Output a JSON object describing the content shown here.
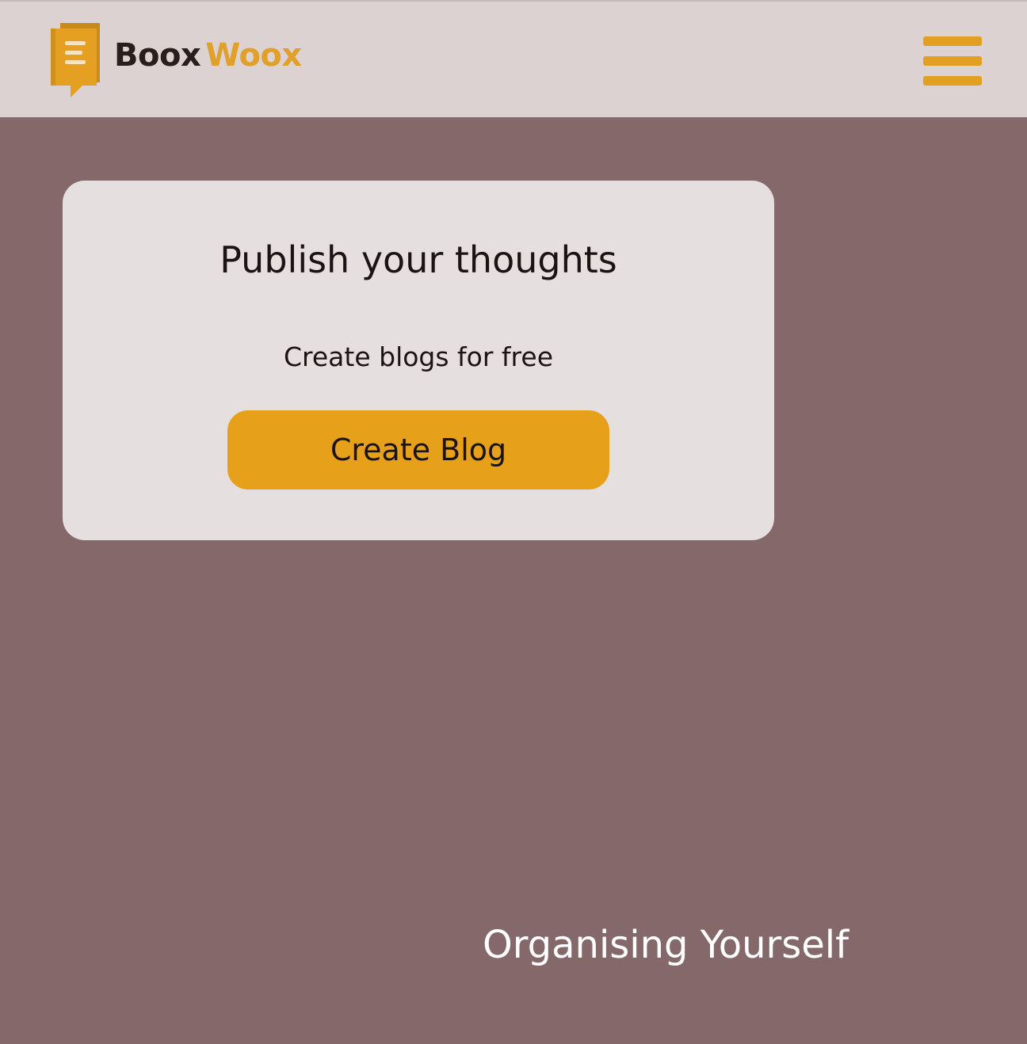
{
  "header": {
    "brand": {
      "word1": "Boox",
      "word2": "Woox",
      "icon": "book-chat-icon"
    },
    "menu_icon": "hamburger-menu-icon"
  },
  "hero_card": {
    "title": "Publish your thoughts",
    "subtitle": "Create blogs for free",
    "button_label": "Create Blog"
  },
  "section": {
    "heading": "Organising Yourself"
  },
  "colors": {
    "page_background": "#85696A",
    "header_background": "#DCD2D2",
    "card_background": "#E6DFDF",
    "accent": "#E6A019",
    "brand_dark": "#2A1E1C",
    "text_dark": "#1B1413",
    "text_light": "#FFFFFF"
  }
}
